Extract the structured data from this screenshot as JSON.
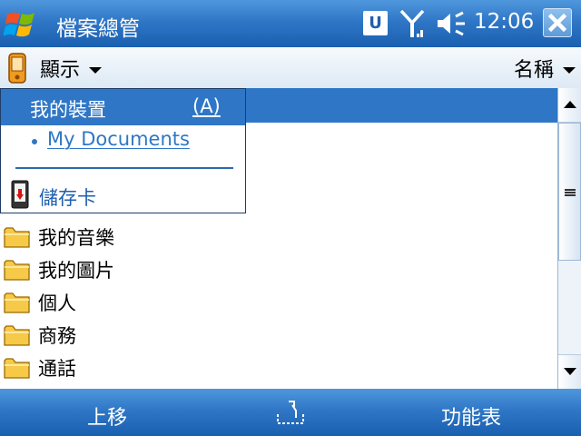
{
  "titlebar": {
    "title": "檔案總管",
    "notification_icon": "U",
    "clock": "12:06"
  },
  "viewbar": {
    "view_label": "顯示",
    "sort_label": "名稱"
  },
  "dropdown": {
    "my_device": "我的裝置",
    "my_device_shortcut": "(A)",
    "my_documents": "My Documents",
    "storage_card": "儲存卡"
  },
  "files": [
    {
      "name": "我的音樂"
    },
    {
      "name": "我的圖片"
    },
    {
      "name": "個人"
    },
    {
      "name": "商務"
    },
    {
      "name": "通話"
    }
  ],
  "softkeys": {
    "left": "上移",
    "right": "功能表"
  },
  "colors": {
    "accent_blue": "#2f77c6",
    "title_gradient_top": "#4f97dc",
    "title_gradient_bottom": "#1a5fb0",
    "folder_yellow": "#f7c948"
  }
}
